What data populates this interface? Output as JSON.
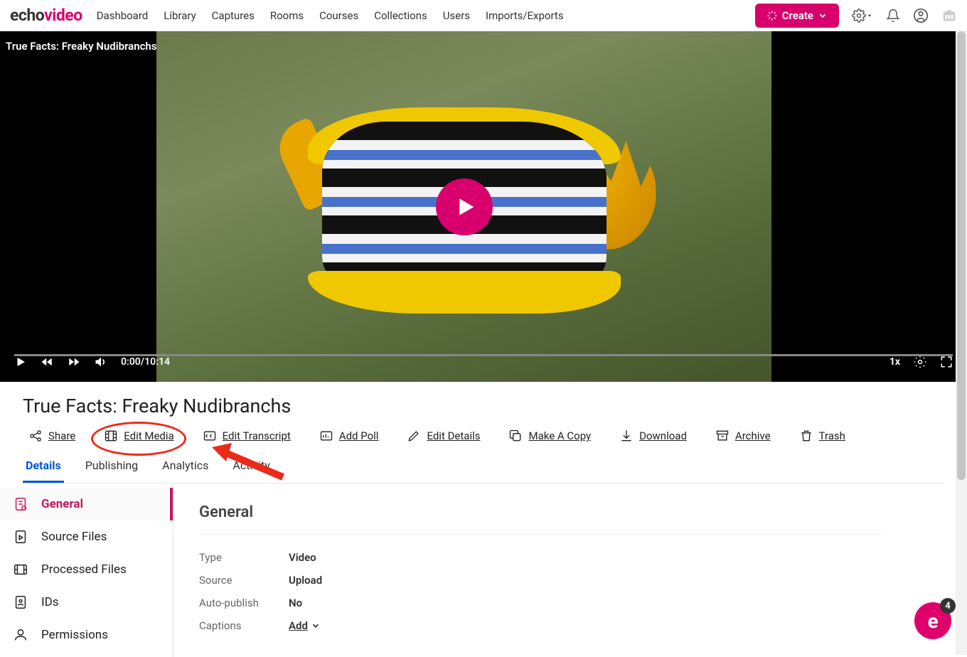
{
  "brand": {
    "part1": "echo",
    "part2": "video"
  },
  "nav": [
    "Dashboard",
    "Library",
    "Captures",
    "Rooms",
    "Courses",
    "Collections",
    "Users",
    "Imports/Exports"
  ],
  "create_label": "Create",
  "video": {
    "overlay_title": "True Facts: Freaky Nudibranchs",
    "time": "0:00/10:14",
    "speed": "1x"
  },
  "media_title": "True Facts: Freaky Nudibranchs",
  "actions": [
    {
      "key": "share",
      "label": "Share"
    },
    {
      "key": "edit-media",
      "label": "Edit Media"
    },
    {
      "key": "edit-transcript",
      "label": "Edit Transcript"
    },
    {
      "key": "add-poll",
      "label": "Add Poll"
    },
    {
      "key": "edit-details",
      "label": "Edit Details"
    },
    {
      "key": "make-a-copy",
      "label": "Make A Copy"
    },
    {
      "key": "download",
      "label": "Download"
    },
    {
      "key": "archive",
      "label": "Archive"
    },
    {
      "key": "trash",
      "label": "Trash"
    }
  ],
  "tabs": [
    "Details",
    "Publishing",
    "Analytics",
    "Activity"
  ],
  "active_tab": "Details",
  "side_items": [
    "General",
    "Source Files",
    "Processed Files",
    "IDs",
    "Permissions"
  ],
  "active_side": "General",
  "general": {
    "heading": "General",
    "rows": [
      {
        "k": "Type",
        "v": "Video"
      },
      {
        "k": "Source",
        "v": "Upload"
      },
      {
        "k": "Auto-publish",
        "v": "No"
      },
      {
        "k": "Captions",
        "v": "Add",
        "link": true
      }
    ]
  },
  "chat_badge": "4"
}
